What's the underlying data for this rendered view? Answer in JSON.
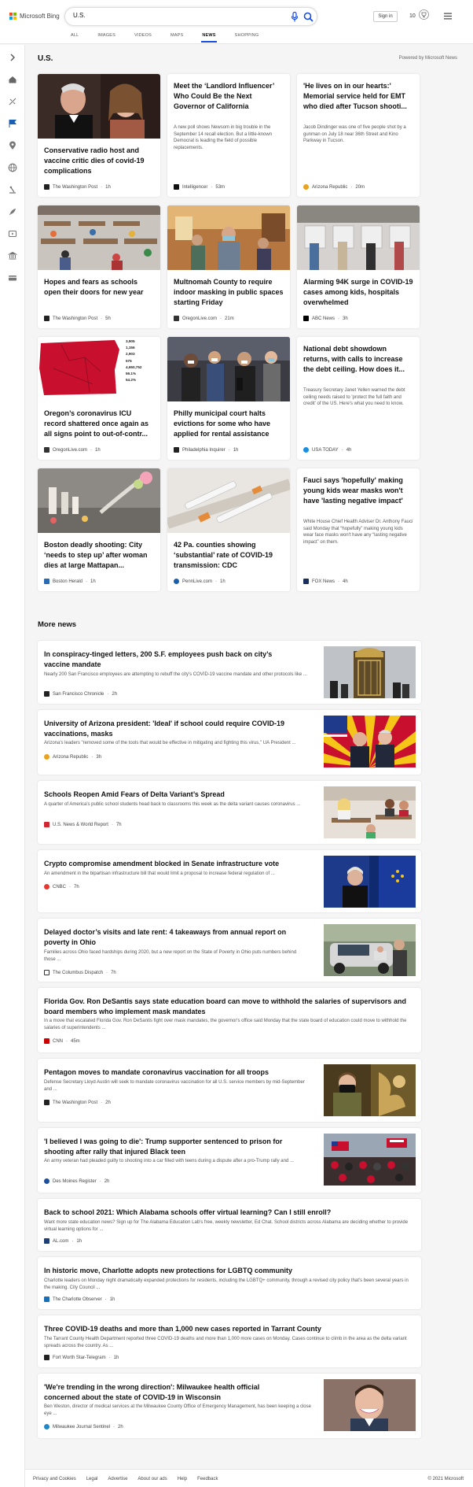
{
  "header": {
    "logo_text": "Microsoft Bing",
    "search_value": "U.S.",
    "signin_label": "Sign in",
    "points": "10",
    "tabs": [
      {
        "label": "ALL"
      },
      {
        "label": "IMAGES"
      },
      {
        "label": "VIDEOS"
      },
      {
        "label": "MAPS"
      },
      {
        "label": "NEWS"
      },
      {
        "label": "SHOPPING"
      }
    ],
    "active_tab": "NEWS"
  },
  "main": {
    "title": "U.S.",
    "powered_by": "Powered by Microsoft News",
    "more_news_title": "More news"
  },
  "cards": [
    {
      "title": "Conservative radio host and vaccine critic dies of covid-19 complications",
      "snippet": "",
      "source": "The Washington Post",
      "time": "1h",
      "source_color": "#222222"
    },
    {
      "title": "Meet the ‘Landlord Influencer’ Who Could Be the Next Governor of California",
      "snippet": "A new poll shows Newsom in big trouble in the September 14 recall election. But a little-known Democrat is leading the field of possible replacements.",
      "source": "Intelligencer",
      "time": "53m",
      "source_color": "#111111"
    },
    {
      "title": "'He lives on in our hearts:' Memorial service held for EMT who died after Tucson shooti...",
      "snippet": "Jacob Dindinger was one of five people shot by a gunman on July 18 near 36th Street and Kino Parkway in Tucson.",
      "source": "Arizona Republic",
      "time": "20m",
      "source_color": "#e8a21f"
    },
    {
      "title": "Hopes and fears as schools open their doors for new year",
      "snippet": "",
      "source": "The Washington Post",
      "time": "5h",
      "source_color": "#222222"
    },
    {
      "title": "Multnomah County to require indoor masking in public spaces starting Friday",
      "snippet": "",
      "source": "OregonLive.com",
      "time": "21m",
      "source_color": "#333333"
    },
    {
      "title": "Alarming 94K surge in COVID-19 cases among kids, hospitals overwhelmed",
      "snippet": "",
      "source": "ABC News",
      "time": "3h",
      "source_color": "#000000"
    },
    {
      "title": "Oregon’s coronavirus ICU record shattered once again as all signs point to out-of-contr...",
      "snippet": "",
      "source": "OregonLive.com",
      "time": "1h",
      "source_color": "#333333"
    },
    {
      "title": "Philly municipal court halts evictions for some who have applied for rental assistance",
      "snippet": "",
      "source": "Philadelphia Inquirer",
      "time": "1h",
      "source_color": "#222222"
    },
    {
      "title": "National debt showdown returns, with calls to increase the debt ceiling. How does it...",
      "snippet": "Treasury Secretary Janet Yellen warned the debt ceiling needs raised to 'protect the full faith and credit' of the US. Here's what you need to know.",
      "source": "USA TODAY",
      "time": "4h",
      "source_color": "#1a8ee1"
    },
    {
      "title": "Boston deadly shooting: City ‘needs to step up’ after woman dies at large Mattapan...",
      "snippet": "",
      "source": "Boston Herald",
      "time": "1h",
      "source_color": "#2a6ab5"
    },
    {
      "title": "42 Pa. counties showing ‘substantial’ rate of COVID-19 transmission: CDC",
      "snippet": "",
      "source": "PennLive.com",
      "time": "1h",
      "source_color": "#1c5fa8"
    },
    {
      "title": "Fauci says 'hopefully' making young kids wear masks won't have 'lasting negative impact'",
      "snippet": "White House Chief Health Adviser Dr. Anthony Fauci said Monday that “hopefully” making young kids wear face masks won't have any “lasting negative impact” on them.",
      "source": "FOX News",
      "time": "4h",
      "source_color": "#1b2f5c"
    }
  ],
  "map_card": {
    "stats": [
      "3,905",
      "1,156",
      "2,903",
      "575",
      "4,650,752",
      "59.1%",
      "54.2%"
    ]
  },
  "more_news": [
    {
      "title": "In conspiracy-tinged letters, 200 S.F. employees push back on city’s vaccine mandate",
      "snippet": "Nearly 200 San Francisco employees are attempting to rebuff the city's COVID-19 vaccine mandate and other protocols like ...",
      "source": "San Francisco Chronicle",
      "time": "2h",
      "source_color": "#222222"
    },
    {
      "title": "University of Arizona president: 'Ideal' if school could require COVID-19 vaccinations, masks",
      "snippet": "Arizona's leaders \"removed some of the tools that would be effective in mitigating and fighting this virus,\" UA President ...",
      "source": "Arizona Republic",
      "time": "3h",
      "source_color": "#e8a21f"
    },
    {
      "title": "Schools Reopen Amid Fears of Delta Variant’s Spread",
      "snippet": "A quarter of America's public school students head back to classrooms this week as the delta variant causes coronavirus ...",
      "source": "U.S. News & World Report",
      "time": "7h",
      "source_color": "#d22630"
    },
    {
      "title": "Crypto compromise amendment blocked in Senate infrastructure vote",
      "snippet": "An amendment in the bipartisan infrastructure bill that would limit a proposal to increase federal regulation of ...",
      "source": "CNBC",
      "time": "7h",
      "source_color": "#e8382d"
    },
    {
      "title": "Delayed doctor’s visits and late rent: 4 takeaways from annual report on poverty in Ohio",
      "snippet": "Families across Ohio faced hardships during 2020, but a new report on the State of Poverty in Ohio puts numbers behind those ...",
      "source": "The Columbus Dispatch",
      "time": "7h",
      "source_color": "#333333"
    },
    {
      "title": "Florida Gov. Ron DeSantis says state education board can move to withhold the salaries of supervisors and board members who implement mask mandates",
      "snippet": "In a move that escalated Florida Gov. Ron DeSantis fight over mask mandates, the governor's office said Monday that the state board of education could move to withhold the salaries of superintendents ...",
      "source": "CNN",
      "time": "45m",
      "source_color": "#cc0000"
    },
    {
      "title": "Pentagon moves to mandate coronavirus vaccination for all troops",
      "snippet": "Defense Secretary Lloyd Austin will seek to mandate coronavirus vaccination for all U.S. service members by mid-September and ...",
      "source": "The Washington Post",
      "time": "2h",
      "source_color": "#222222"
    },
    {
      "title": "'I believed I was going to die': Trump supporter sentenced to prison for shooting after rally that injured Black teen",
      "snippet": "An army veteran had pleaded guilty to shooting into a car filled with teens during a dispute after a pro-Trump rally and ...",
      "source": "Des Moines Register",
      "time": "2h",
      "source_color": "#1c4f9c"
    },
    {
      "title": "Back to school 2021: Which Alabama schools offer virtual learning? Can I still enroll?",
      "snippet": "Want more state education news? Sign up for The Alabama Education Lab's free, weekly newsletter, Ed Chat. School districts across Alabama are deciding whether to provide virtual learning options for ...",
      "source": "AL.com",
      "time": "1h",
      "source_color": "#1d3f73"
    },
    {
      "title": "In historic move, Charlotte adopts new protections for LGBTQ community",
      "snippet": "Charlotte leaders on Monday night dramatically expanded protections for residents, including the LGBTQ+ community, through a revised city policy that's been several years in the making. City Council ...",
      "source": "The Charlotte Observer",
      "time": "1h",
      "source_color": "#1b6fb5"
    },
    {
      "title": "Three COVID-19 deaths and more than 1,000 new cases reported in Tarrant County",
      "snippet": "The Tarrant County Health Department reported three COVID-19 deaths and more than 1,000 more cases on Monday. Cases continue to climb in the area as the delta variant spreads across the country. As ...",
      "source": "Fort Worth Star-Telegram",
      "time": "1h",
      "source_color": "#222222"
    },
    {
      "title": "'We're trending in the wrong direction': Milwaukee health official concerned about the state of COVID-19 in Wisconsin",
      "snippet": "Ben Weston, director of medical services at the Milwaukee County Office of Emergency Management, has been keeping a close eye ...",
      "source": "Milwaukee Journal Sentinel",
      "time": "2h",
      "source_color": "#1e88c8"
    }
  ],
  "footer": {
    "links": [
      "Privacy and Cookies",
      "Legal",
      "Advertise",
      "About our ads",
      "Help",
      "Feedback"
    ],
    "copyright": "© 2021 Microsoft"
  },
  "colors": {
    "accent": "#174ae4",
    "ms_red": "#f25022",
    "ms_green": "#7fba00",
    "ms_blue": "#00a4ef",
    "ms_yellow": "#ffb900"
  }
}
